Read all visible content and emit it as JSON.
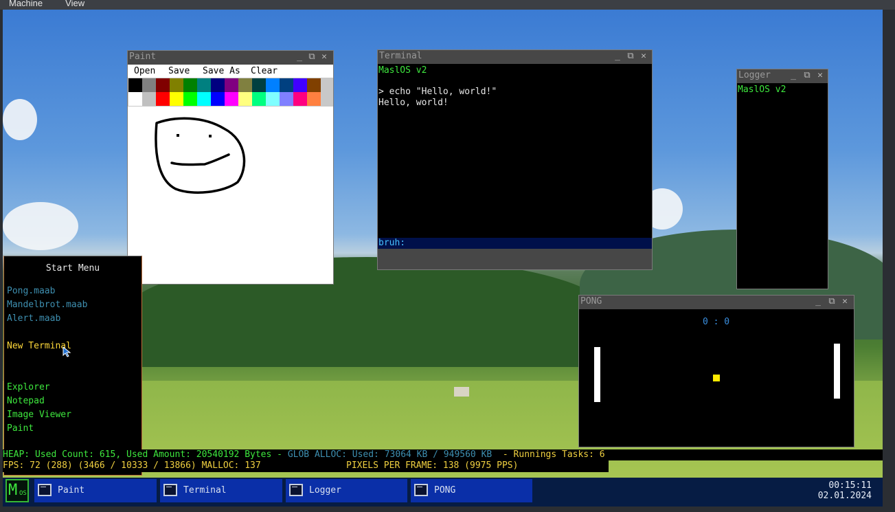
{
  "host": {
    "menu": [
      "Machine",
      "View"
    ]
  },
  "paint": {
    "title": "Paint",
    "menu": [
      "Open",
      "Save",
      "Save As",
      "Clear"
    ],
    "palette_row1": [
      "#000000",
      "#808080",
      "#800000",
      "#808000",
      "#008000",
      "#008080",
      "#000080",
      "#800080",
      "#808040",
      "#004040",
      "#0080ff",
      "#004080",
      "#4000ff",
      "#804000"
    ],
    "palette_row2": [
      "#ffffff",
      "#c0c0c0",
      "#ff0000",
      "#ffff00",
      "#00ff00",
      "#00ffff",
      "#0000ff",
      "#ff00ff",
      "#ffff80",
      "#00ff80",
      "#80ffff",
      "#8080ff",
      "#ff0080",
      "#ff8040"
    ]
  },
  "terminal": {
    "title": "Terminal",
    "lines": [
      "MaslOS v2",
      "",
      "> echo \"Hello, world!\"",
      "Hello, world!"
    ],
    "input_prompt": "bruh:"
  },
  "logger": {
    "title": "Logger",
    "lines": [
      "MaslOS v2"
    ]
  },
  "pong": {
    "title": "PONG",
    "score": "0 : 0"
  },
  "start_menu": {
    "title": "Start Menu",
    "apps": [
      "Pong.maab",
      "Mandelbrot.maab",
      "Alert.maab"
    ],
    "new_terminal": "New Terminal",
    "programs": [
      "Explorer",
      "Notepad",
      "Image Viewer",
      "Paint"
    ]
  },
  "status": {
    "heap": "HEAP: Used Count: 615, Used Amount: 20540192 Bytes - ",
    "glob": "GLOB ALLOC: Used: 73064 KB / 949560 KB ",
    "tasks": " - Runnings Tasks: 6",
    "fps": "FPS: 72 (288) (3466 / 10333 / 13866) MALLOC: 137",
    "ppf": "PIXELS PER FRAME: 138 (9975 PPS)"
  },
  "taskbar": {
    "logo": "MOS",
    "tasks": [
      "Paint",
      "Terminal",
      "Logger",
      "PONG"
    ],
    "time": "00:15:11",
    "date": "02.01.2024"
  },
  "colors": {
    "accent_green": "#3ee83e",
    "status_yellow": "#f0d040",
    "link_blue": "#3e8fb0",
    "taskbar_blue": "#0a2fa8"
  }
}
